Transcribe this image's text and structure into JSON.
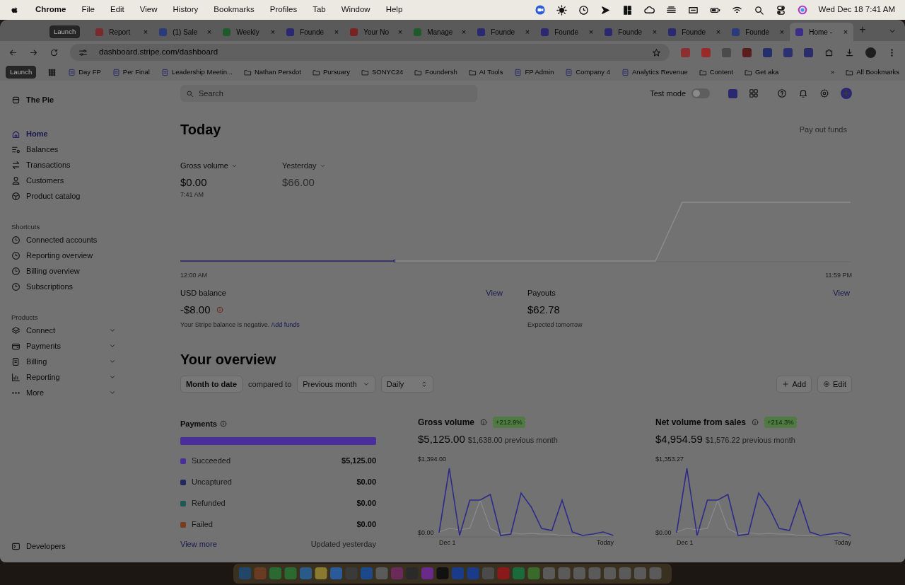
{
  "menu_bar": {
    "app": "Chrome",
    "menus": [
      "File",
      "Edit",
      "View",
      "History",
      "Bookmarks",
      "Profiles",
      "Tab",
      "Window",
      "Help"
    ],
    "clock": "Wed Dec 18  7:41 AM"
  },
  "browser": {
    "tab_group": "Launch",
    "tabs": [
      {
        "title": "Report",
        "selected": false,
        "color": "#7a2a2a"
      },
      {
        "title": "(1) Sale",
        "selected": false,
        "color": "#2a3a7a"
      },
      {
        "title": "Weekly",
        "selected": false,
        "color": "#1f5a2a"
      },
      {
        "title": "Founde",
        "selected": false,
        "color": "#2a2870"
      },
      {
        "title": "Your No",
        "selected": false,
        "color": "#7a2222"
      },
      {
        "title": "Manage",
        "selected": false,
        "color": "#1f5a2a"
      },
      {
        "title": "Founde",
        "selected": false,
        "color": "#2a2870"
      },
      {
        "title": "Founde",
        "selected": false,
        "color": "#2a2870"
      },
      {
        "title": "Founde",
        "selected": false,
        "color": "#2a2870"
      },
      {
        "title": "Founde",
        "selected": false,
        "color": "#2a2870"
      },
      {
        "title": "Founde",
        "selected": false,
        "color": "#2a3a7a"
      },
      {
        "title": "Home -",
        "selected": true,
        "color": "#3a2e8a"
      }
    ],
    "url": "dashboard.stripe.com/dashboard",
    "bookmarks": [
      {
        "label": "Launch",
        "kind": "chip"
      },
      {
        "kind": "apps"
      },
      {
        "label": "Day FP",
        "kind": "page"
      },
      {
        "label": "Per Final",
        "kind": "page"
      },
      {
        "label": "Leadership Meetin...",
        "kind": "page"
      },
      {
        "label": "Nathan Persdot",
        "kind": "folder"
      },
      {
        "label": "Pursuary",
        "kind": "folder"
      },
      {
        "label": "SONYC24",
        "kind": "folder"
      },
      {
        "label": "Foundersh",
        "kind": "folder"
      },
      {
        "label": "AI Tools",
        "kind": "folder"
      },
      {
        "label": "FP Admin",
        "kind": "page"
      },
      {
        "label": "Company 4",
        "kind": "page"
      },
      {
        "label": "Analytics Revenue",
        "kind": "page"
      },
      {
        "label": "Content",
        "kind": "folder"
      },
      {
        "label": "Get aka",
        "kind": "folder"
      }
    ],
    "close": "×",
    "new_tab": "+",
    "overflow": "»",
    "all_bookmarks": "All Bookmarks"
  },
  "sidebar": {
    "account": "The Pie",
    "nav": [
      {
        "label": "Home",
        "selected": true
      },
      {
        "label": "Balances",
        "selected": false
      },
      {
        "label": "Transactions",
        "selected": false
      },
      {
        "label": "Customers",
        "selected": false
      },
      {
        "label": "Product catalog",
        "selected": false
      }
    ],
    "shortcuts_heading": "Shortcuts",
    "shortcuts": [
      "Connected accounts",
      "Reporting overview",
      "Billing overview",
      "Subscriptions"
    ],
    "products_heading": "Products",
    "products": [
      "Connect",
      "Payments",
      "Billing",
      "Reporting",
      "More"
    ],
    "developers": "Developers"
  },
  "header": {
    "search_placeholder": "Search",
    "test_mode": {
      "label": "Test mode",
      "on": false
    }
  },
  "today": {
    "title": "Today",
    "payout_button": "Pay out funds",
    "metrics": [
      {
        "label": "Gross volume",
        "value": "$0.00",
        "time": "7:41 AM",
        "kind": "primary"
      },
      {
        "label": "Yesterday",
        "value": "$66.00",
        "kind": "comparison"
      }
    ],
    "axis_start": "12:00 AM",
    "axis_end": "11:59 PM"
  },
  "balances": [
    {
      "label": "USD balance",
      "link": "View",
      "value": "-$8.00",
      "alert": true,
      "note": "Your Stripe balance is negative.",
      "note_link": "Add funds"
    },
    {
      "label": "Payouts",
      "link": "View",
      "value": "$62.78",
      "alert": false,
      "note": "Expected tomorrow"
    }
  ],
  "overview": {
    "title": "Your overview",
    "range": "Month to date",
    "compared_to": "compared to",
    "comparison": "Previous month",
    "interval": "Daily",
    "add": "Add",
    "edit": "Edit"
  },
  "payments": {
    "title": "Payments",
    "rows": [
      {
        "label": "Succeeded",
        "amount": "$5,125.00",
        "color": "#4a2e9a"
      },
      {
        "label": "Uncaptured",
        "amount": "$0.00",
        "color": "#1f2a5e"
      },
      {
        "label": "Refunded",
        "amount": "$0.00",
        "color": "#1d5a55"
      },
      {
        "label": "Failed",
        "amount": "$0.00",
        "color": "#7a3a1e"
      }
    ],
    "view_more": "View more",
    "updated": "Updated yesterday"
  },
  "charts": [
    {
      "title": "Gross volume",
      "change": "+212.9%",
      "value": "$5,125.00",
      "previous": "$1,638.00 previous month",
      "y_max": "$1,394.00",
      "y_min": "$0.00",
      "x_start": "Dec 1",
      "x_end": "Today"
    },
    {
      "title": "Net volume from sales",
      "change": "+214.3%",
      "value": "$4,954.59",
      "previous": "$1,576.22 previous month",
      "y_max": "$1,353.27",
      "y_min": "$0.00",
      "x_start": "Dec 1",
      "x_end": "Today"
    }
  ]
}
